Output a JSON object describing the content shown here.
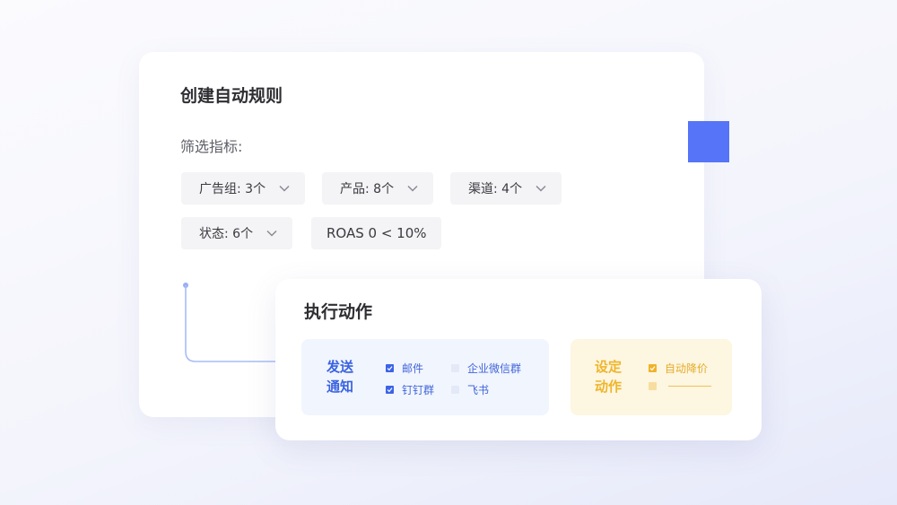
{
  "rule_card": {
    "title": "创建自动规则",
    "filter_label": "筛选指标:",
    "filters": [
      {
        "label": "广告组: 3个"
      },
      {
        "label": "产品: 8个"
      },
      {
        "label": "渠道: 4个"
      },
      {
        "label": "状态: 6个"
      },
      {
        "label": "ROAS 0 < 10%"
      }
    ]
  },
  "action_card": {
    "title": "执行动作",
    "notify": {
      "label": "发送通知",
      "options": [
        {
          "label": "邮件",
          "checked": true
        },
        {
          "label": "企业微信群",
          "checked": false
        },
        {
          "label": "钉钉群",
          "checked": true
        },
        {
          "label": "飞书",
          "checked": false
        }
      ]
    },
    "set_action": {
      "label": "设定动作",
      "options": [
        {
          "label": "自动降价",
          "checked": true
        },
        {
          "label": "",
          "checked": false
        }
      ]
    }
  },
  "colors": {
    "accent_blue": "#5574f7",
    "notify_text": "#3a63e0",
    "action_yellow": "#efb52b"
  }
}
